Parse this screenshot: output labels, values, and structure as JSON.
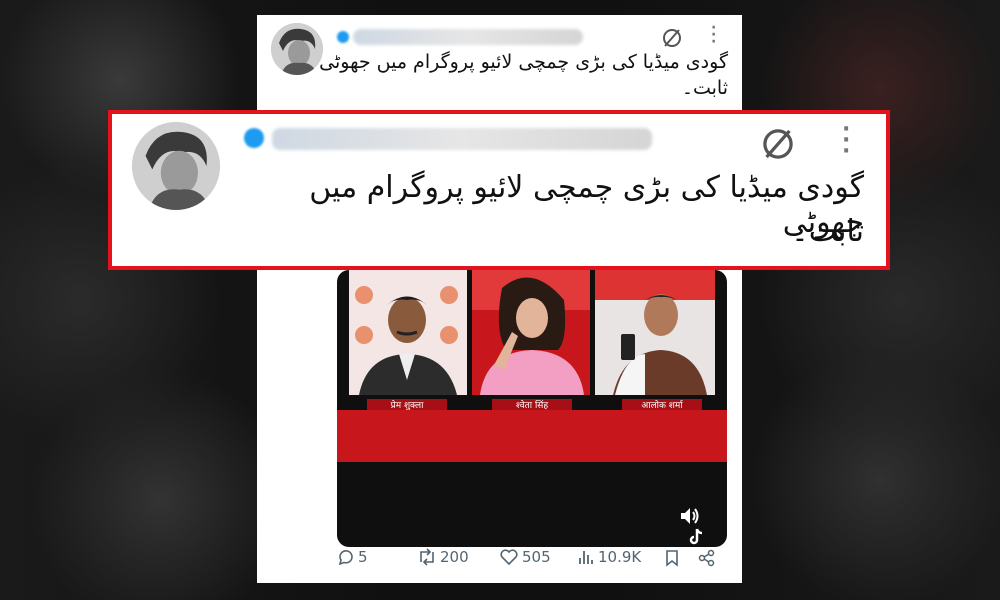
{
  "background": {
    "description_color": "#141414"
  },
  "colors": {
    "highlight_border": "#e4121d",
    "icon_grey": "#536471",
    "video_red": "#c8161d"
  },
  "tweet": {
    "author": {
      "avatar_icon": "avatar-image"
    },
    "text_line1": "گودی میڈیا کی بڑی چمچی لائیو پروگرام میں جھوٹی",
    "text_line2": "ثابت۔",
    "menu_icon": "more-options-icon",
    "grok_icon": "grok-icon"
  },
  "zoom": {
    "text_line1": "گودی میڈیا کی بڑی چمچی لائیو پروگرام میں جھوٹی",
    "text_line2": "ثابت۔"
  },
  "video": {
    "captions": [
      "प्रेम शुक्ला",
      "श्वेता सिंह",
      "आलोक शर्मा"
    ],
    "volume_icon": "volume-icon",
    "tiktok_icon": "tiktok-icon"
  },
  "actions": {
    "replies": "5",
    "reposts": "200",
    "likes": "505",
    "views": "10.9K"
  }
}
